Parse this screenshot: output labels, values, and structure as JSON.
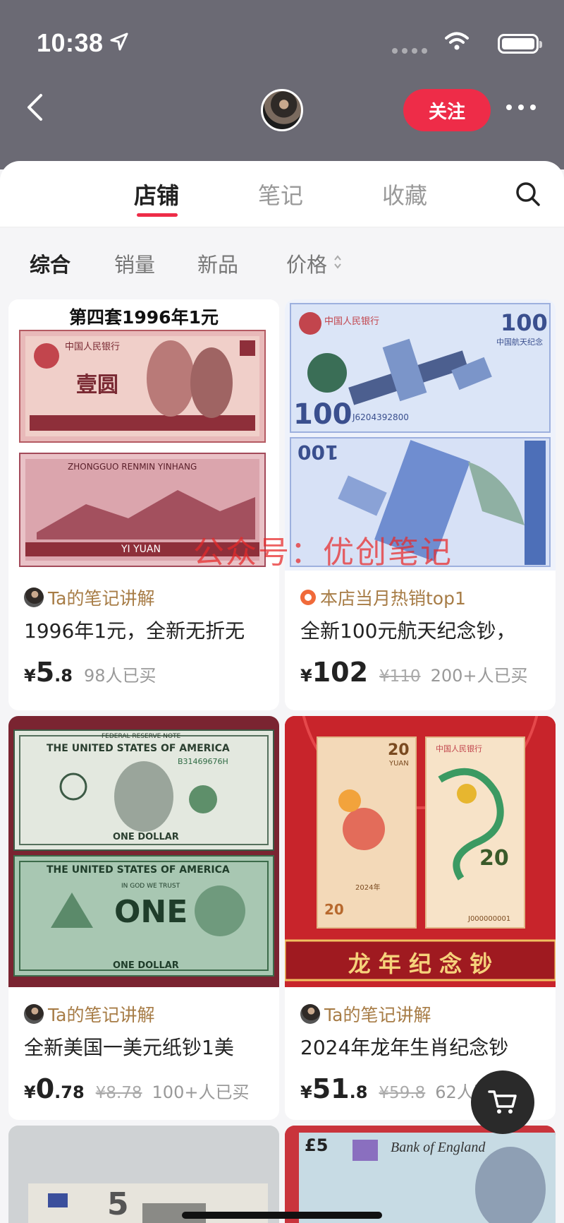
{
  "status_bar": {
    "time": "10:38"
  },
  "header": {
    "follow_label": "关注"
  },
  "tabs": [
    {
      "label": "店铺",
      "active": true
    },
    {
      "label": "笔记",
      "active": false
    },
    {
      "label": "收藏",
      "active": false
    }
  ],
  "filters": [
    {
      "label": "综合",
      "active": true
    },
    {
      "label": "销量",
      "active": false
    },
    {
      "label": "新品",
      "active": false
    },
    {
      "label": "价格",
      "active": false
    }
  ],
  "watermark": "公众号：优创笔记",
  "products": [
    {
      "image_caption": "第四套1996年1元",
      "tag": "Ta的笔记讲解",
      "title": "1996年1元，全新无折无",
      "price_int": "5",
      "price_dec": ".8",
      "original_price": "",
      "sold": "98人已买"
    },
    {
      "tag": "本店当月热销top1",
      "title": "全新100元航天纪念钞，",
      "price_int": "102",
      "price_dec": "",
      "original_price": "¥110",
      "sold": "200+人已买"
    },
    {
      "tag": "Ta的笔记讲解",
      "title": "全新美国一美元纸钞1美",
      "price_int": "0",
      "price_dec": ".78",
      "original_price": "¥8.78",
      "sold": "100+人已买"
    },
    {
      "image_caption": "龙 年 纪 念 钞",
      "tag": "Ta的笔记讲解",
      "title": "2024年龙年生肖纪念钞",
      "price_int": "51",
      "price_dec": ".8",
      "original_price": "¥59.8",
      "sold": "62人已买"
    }
  ],
  "banknote_text": {
    "bank_cn": "中国人民银行",
    "yi_yuan_cn": "壹圆",
    "zhongguo": "ZHONGGUO RENMIN YINHANG",
    "yi_yuan_py": "YI YUAN",
    "space_100": "100",
    "space_caption": "中国航天纪念",
    "serial_space": "J6204392800",
    "us_top": "THE UNITED STATES OF AMERICA",
    "frn": "FEDERAL RESERVE NOTE",
    "one_dollar": "ONE DOLLAR",
    "us_serial": "B31469676H",
    "one": "ONE",
    "in_god": "IN GOD WE TRUST",
    "dragon_20": "20",
    "dragon_yuan": "YUAN",
    "dragon_serial": "J000000001",
    "dragon_year": "2024年",
    "gbp_5": "£5",
    "boe": "Bank of England",
    "euro_5": "5"
  },
  "colors": {
    "accent": "#ee2c48",
    "header_bg": "#6b6a74",
    "tag_gold": "#a77c46"
  },
  "icons": [
    "location-arrow-icon",
    "wifi-icon",
    "battery-icon",
    "back-chevron-icon",
    "more-icon",
    "search-icon",
    "sort-arrows-icon",
    "cart-icon"
  ]
}
